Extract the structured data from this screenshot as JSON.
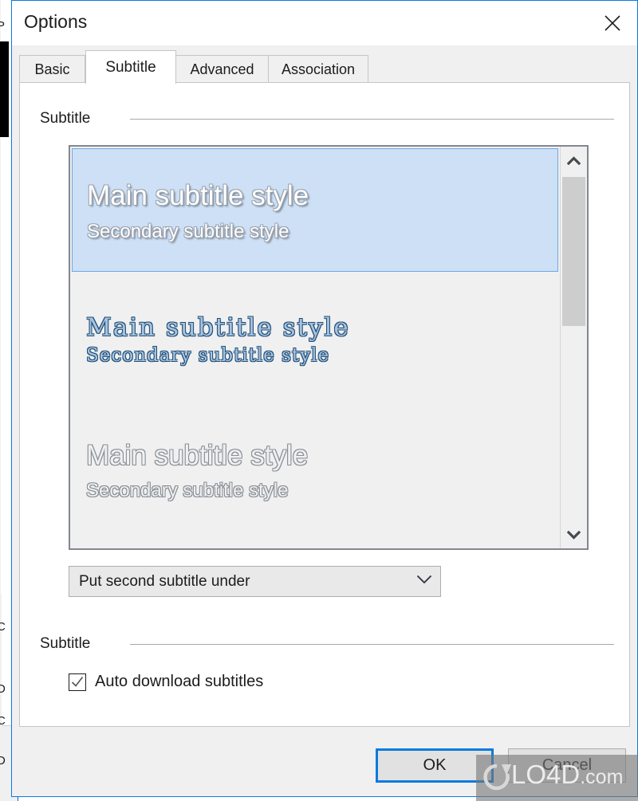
{
  "background_window": {
    "fragments": [
      "P",
      "C",
      "D",
      "C",
      "D"
    ]
  },
  "dialog": {
    "title": "Options",
    "close_icon": "close-icon",
    "tabs": [
      {
        "label": "Basic",
        "selected": false
      },
      {
        "label": "Subtitle",
        "selected": true
      },
      {
        "label": "Advanced",
        "selected": false
      },
      {
        "label": "Association",
        "selected": false
      }
    ],
    "groups": {
      "subtitle_style": {
        "label": "Subtitle"
      },
      "subtitle_download": {
        "label": "Subtitle"
      }
    },
    "style_list": {
      "items": [
        {
          "main": "Main subtitle style",
          "secondary": "Secondary subtitle style",
          "selected": true,
          "appearance": "white-fill-gray-outline-shadow"
        },
        {
          "main": "Main subtitle style",
          "secondary": "Secondary subtitle style",
          "selected": false,
          "appearance": "blue-serif-outline"
        },
        {
          "main": "Main subtitle style",
          "secondary": "Secondary subtitle style",
          "selected": false,
          "appearance": "hollow-outline"
        }
      ],
      "scrollbar": {
        "up_icon": "chevron-up-icon",
        "down_icon": "chevron-down-icon",
        "thumb_name": "scrollbar-thumb"
      }
    },
    "second_subtitle_combo": {
      "value": "Put second subtitle under",
      "arrow_icon": "chevron-down-icon"
    },
    "auto_download": {
      "label": "Auto download subtitles",
      "checked": true,
      "check_icon": "checkmark-icon"
    },
    "buttons": {
      "ok": "OK",
      "cancel": "Cancel"
    },
    "colors": {
      "accent": "#0a7ae0",
      "selection_fill": "#cde0f5",
      "selection_border": "#6ea8e8",
      "panel_bg": "#ffffff",
      "dialog_bg": "#f0f0f0",
      "list_bg": "#f0f0f0",
      "style2_text": "#1f4e79"
    }
  },
  "watermark": {
    "name": "LO4D",
    "suffix": ".com",
    "logo_icon": "refresh-circle-icon"
  }
}
